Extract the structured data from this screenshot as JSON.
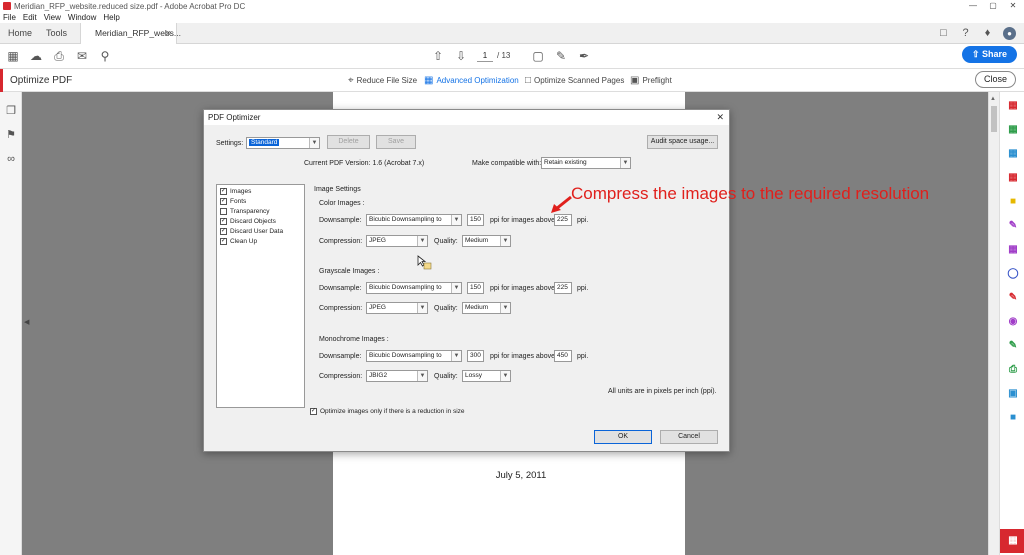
{
  "window": {
    "title": "Meridian_RFP_website.reduced size.pdf - Adobe Acrobat Pro DC",
    "controls": [
      "—",
      "▢",
      "✕"
    ]
  },
  "menu": [
    "File",
    "Edit",
    "View",
    "Window",
    "Help"
  ],
  "tabs": {
    "home": "Home",
    "tools": "Tools",
    "document": "Meridian_RFP_webs...",
    "close_glyph": "×"
  },
  "toolbar": {
    "current_page": "1",
    "total_pages": "/ 13",
    "share_label": "Share"
  },
  "optimize_bar": {
    "title": "Optimize PDF",
    "tools": [
      "Reduce File Size",
      "Advanced Optimization",
      "Optimize Scanned Pages",
      "Preflight"
    ],
    "active_tool": "Advanced Optimization",
    "close_label": "Close"
  },
  "page": {
    "date": "July 5, 2011"
  },
  "dialog": {
    "title": "PDF Optimizer",
    "close_glyph": "✕",
    "settings_label": "Settings:",
    "settings_value": "Standard",
    "delete_label": "Delete",
    "save_label": "Save",
    "audit_label": "Audit space usage...",
    "current_version": "Current PDF Version: 1.6 (Acrobat 7.x)",
    "make_compatible_label": "Make compatible with:",
    "make_compatible_value": "Retain existing",
    "categories": [
      {
        "label": "Images",
        "checked": true
      },
      {
        "label": "Fonts",
        "checked": true
      },
      {
        "label": "Transparency",
        "checked": false
      },
      {
        "label": "Discard Objects",
        "checked": true
      },
      {
        "label": "Discard User Data",
        "checked": true
      },
      {
        "label": "Clean Up",
        "checked": true
      }
    ],
    "image_settings_title": "Image Settings",
    "downsample_label": "Downsample:",
    "compression_label": "Compression:",
    "quality_label": "Quality:",
    "ppi_above_label": "ppi for images above",
    "ppi_label": "ppi.",
    "color": {
      "title": "Color Images :",
      "downsample": "Bicubic Downsampling to",
      "ppi": "150",
      "above": "225",
      "compression": "JPEG",
      "quality": "Medium"
    },
    "grayscale": {
      "title": "Grayscale Images :",
      "downsample": "Bicubic Downsampling to",
      "ppi": "150",
      "above": "225",
      "compression": "JPEG",
      "quality": "Medium"
    },
    "monochrome": {
      "title": "Monochrome Images :",
      "downsample": "Bicubic Downsampling to",
      "ppi": "300",
      "above": "450",
      "compression": "JBIG2",
      "quality": "Lossy"
    },
    "units_note": "All units are in pixels per inch (ppi).",
    "optimize_only_label": "Optimize images only if there is a reduction in size",
    "optimize_only_checked": true,
    "ok_label": "OK",
    "cancel_label": "Cancel"
  },
  "annotation": {
    "text": "Compress the images to the required resolution",
    "color": "#e0201c"
  },
  "colors": {
    "accent_red": "#d7282f",
    "share_blue": "#1473e6",
    "canvas_gray": "#7f7f7f"
  }
}
